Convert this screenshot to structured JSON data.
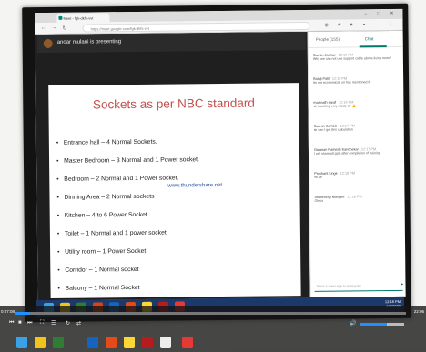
{
  "browser": {
    "tab_title": "Meet - fgk-dkfs-vvt",
    "url": "https://meet.google.com/fgk-dkfs-vvt",
    "nav": {
      "back": "←",
      "forward": "→",
      "reload": "↻"
    },
    "window_controls": [
      "–",
      "□",
      "✕"
    ]
  },
  "meet": {
    "presenter": "anoar mulani is presenting",
    "panel_tabs": {
      "people": "People (155)",
      "chat": "Chat"
    },
    "chat_messages": [
      {
        "name": "Sachin Jadhav",
        "time": "12:16 PM",
        "text": "Why we can not use support cable above living room?"
      },
      {
        "name": "Balaji Patil",
        "time": "12:16 PM",
        "text": "Its not economical, sir has mentioned it"
      },
      {
        "name": "mallinath saraf",
        "time": "12:16 PM",
        "text": "sir teaching very nicely sir 👍"
      },
      {
        "name": "Suresh Kamble",
        "time": "12:17 PM",
        "text": "sir can I get this calculation"
      },
      {
        "name": "Gajanan Ramesh Kandhekar",
        "time": "12:17 PM",
        "text": "I will share all ppts after completion of training"
      },
      {
        "name": "Prashant Linge",
        "time": "12:18 PM",
        "text": "ok sir"
      },
      {
        "name": "Shubhangi Manjare",
        "time": "12:18 PM",
        "text": "Ok sir"
      }
    ],
    "chat_placeholder": "Send a message to everyone"
  },
  "slide": {
    "title": "Sockets as per NBC standard",
    "watermark": "www.thundershare.net",
    "bullets": [
      "Entrance hall – 4 Normal Sockets.",
      "Master Bedroom – 3 Normal and 1 Power socket.",
      "Bedroom – 2 Normal and 1 Power socket.",
      "Dinning Area – 2 Normal sockets",
      "Kitchen – 4 to 6 Power Socket",
      "Toilet – 1 Normal and 1 power socket",
      "Utility room – 1 Power Socket",
      "Corridor – 1 Normal socket",
      "Balcony – 1 Normal Socket"
    ]
  },
  "taskbar": {
    "time": "12:18 PM",
    "date": "6/3/2020"
  },
  "player": {
    "elapsed": "0:07:08",
    "total": "22:06",
    "progress": 0.04,
    "volume": 0.6
  },
  "colors": {
    "slide_title": "#c0504d",
    "meet_accent": "#00796b",
    "progress": "#1e90ff",
    "taskbar": "#1b3a6b"
  }
}
